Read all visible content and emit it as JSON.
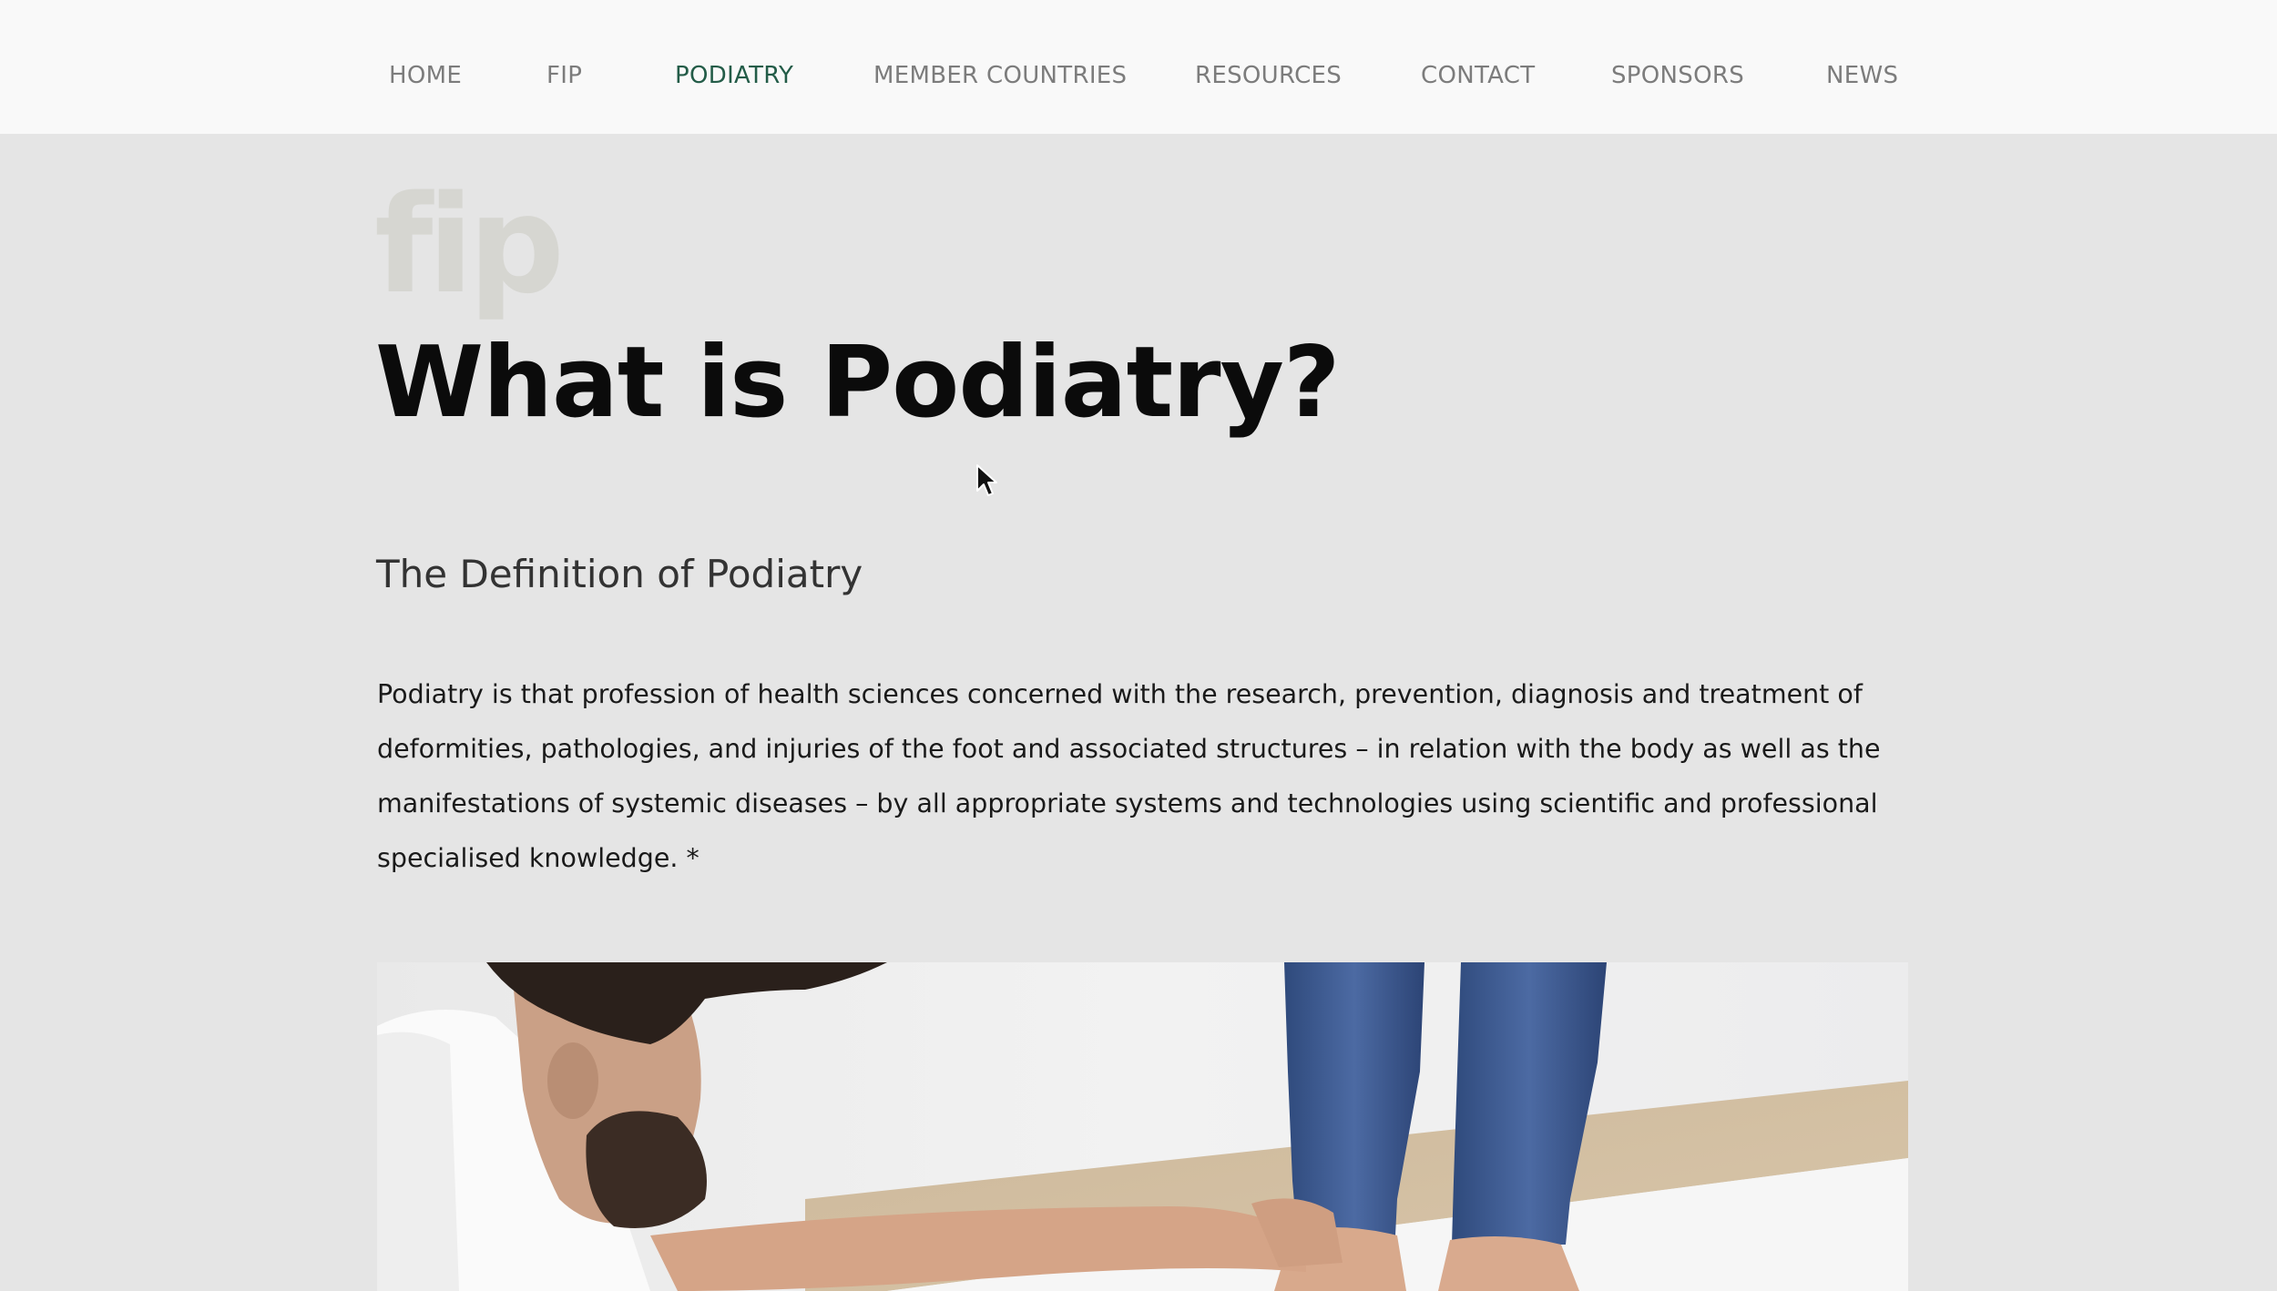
{
  "nav": {
    "items": [
      {
        "label": "HOME"
      },
      {
        "label": "FIP"
      },
      {
        "label": "PODIATRY",
        "active": true
      },
      {
        "label": "MEMBER COUNTRIES"
      },
      {
        "label": "RESOURCES"
      },
      {
        "label": "CONTACT"
      },
      {
        "label": "SPONSORS"
      },
      {
        "label": "NEWS"
      }
    ],
    "active_color": "#235c48"
  },
  "logo": {
    "text": "fip"
  },
  "main": {
    "title": "What is Podiatry?",
    "subtitle": "The Definition of Podiatry",
    "body": "Podiatry is that profession of health sciences concerned with the research, prevention, diagnosis and treatment of deformities, pathologies, and injuries of the foot and associated structures – in relation with the body as well as the manifestations of systemic diseases – by all appropriate systems and technologies using scientific and professional specialised knowledge. *"
  },
  "colors": {
    "page_background": "#e5e5e5",
    "header_background": "#f9f9f9"
  }
}
